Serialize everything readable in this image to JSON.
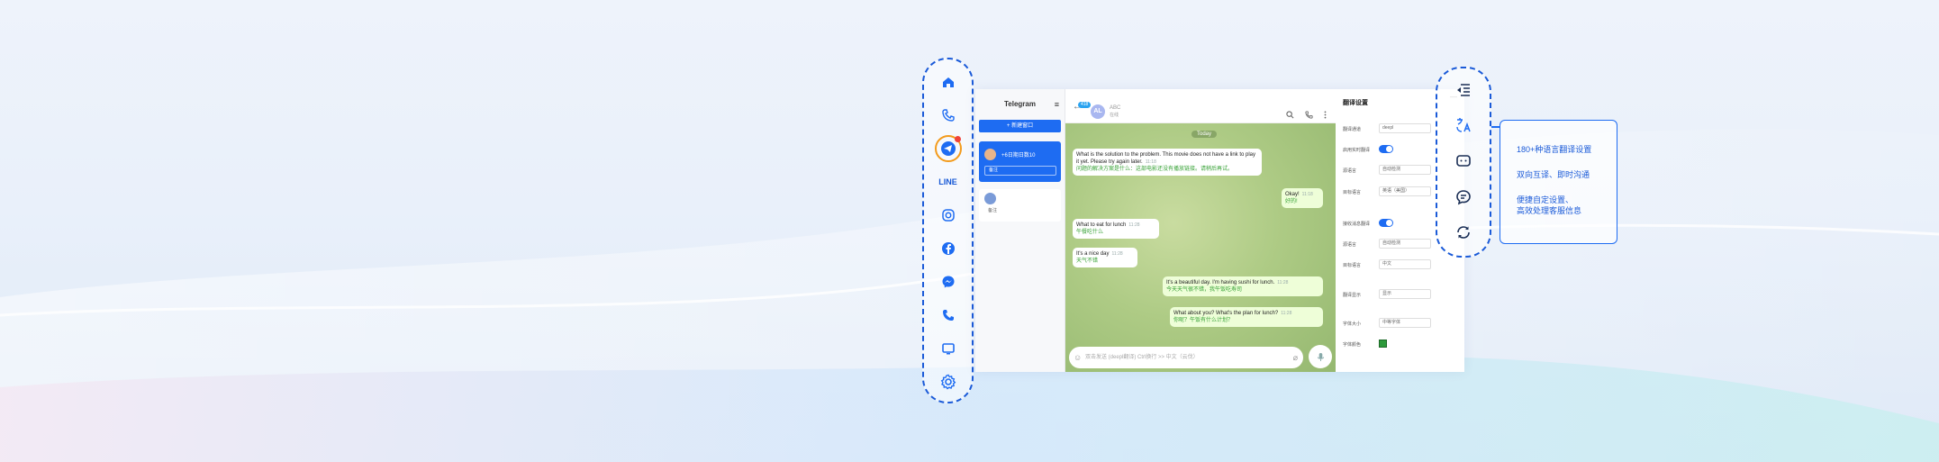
{
  "left_rail": {
    "icons": [
      "home-icon",
      "phone-icon",
      "telegram-icon",
      "line-icon",
      "instagram-icon",
      "facebook-icon",
      "messenger-icon",
      "phone-icon",
      "monitor-icon",
      "settings-icon"
    ],
    "line_label": "LINE"
  },
  "chat_list": {
    "title": "Telegram",
    "new_chat_label": "+ 新建窗口",
    "items": [
      {
        "name": "+6日期日数10",
        "note": "备注"
      },
      {
        "name": "",
        "note": "备注"
      }
    ]
  },
  "chat_header": {
    "badge": "418",
    "avatar_initials": "AL",
    "name": "ABC",
    "status": "在线"
  },
  "messages": {
    "date_label": "Today",
    "items": [
      {
        "text": "What is the solution to the problem. This movie does not have a link to play it yet. Please try again later.",
        "time": "11:18",
        "translation": "问题的解决方案是什么：这部电影还没有播放链接。请稍后再试。",
        "dir": "in"
      },
      {
        "text": "Okay!",
        "time": "11:18",
        "translation": "好的!",
        "dir": "out"
      },
      {
        "text": "What to eat for lunch",
        "time": "11:28",
        "translation": "午餐吃什么",
        "dir": "in"
      },
      {
        "text": "It's a nice day",
        "time": "11:28",
        "translation": "天气不错",
        "dir": "in"
      },
      {
        "text": "It's a beautiful day. I'm having sushi for lunch.",
        "time": "11:28",
        "translation": "今天天气很不错，我午饭吃寿司",
        "dir": "out"
      },
      {
        "text": "What about you? What's the plan for lunch?",
        "time": "11:28",
        "translation": "你呢？午饭有什么计划？",
        "dir": "out"
      }
    ]
  },
  "input": {
    "placeholder": "双击发送 (deepl翻译) Ctrl换行 >> 中文（云伐）"
  },
  "settings": {
    "title": "翻译设置",
    "rows": [
      {
        "label": "翻译通道",
        "value": "deepl"
      },
      {
        "label": "启用实时翻译",
        "value": ""
      },
      {
        "label": "源语言",
        "value": "自动检测"
      },
      {
        "label": "目标语言",
        "value": "英语（美国）"
      },
      {
        "label": "接收消息翻译",
        "value": ""
      },
      {
        "label": "源语言",
        "value": "自动检测"
      },
      {
        "label": "目标语言",
        "value": "中文"
      },
      {
        "label": "翻译显示",
        "value": "显示"
      },
      {
        "label": "字体大小",
        "value": "中等字体"
      },
      {
        "label": "字体颜色",
        "value": ""
      }
    ],
    "font_color": "#2d9a3b"
  },
  "right_rail": {
    "icons": [
      "collapse-icon",
      "translate-icon",
      "quick-reply-icon",
      "chat-bubble-icon",
      "refresh-icon"
    ]
  },
  "callout": {
    "lines": [
      "180+种语言翻译设置",
      "双向互译、即时沟通",
      "便捷自定设置、",
      "高效处理客服信息"
    ]
  },
  "colors": {
    "accent": "#1e6cf2",
    "telegram": "#2aa3f0"
  }
}
